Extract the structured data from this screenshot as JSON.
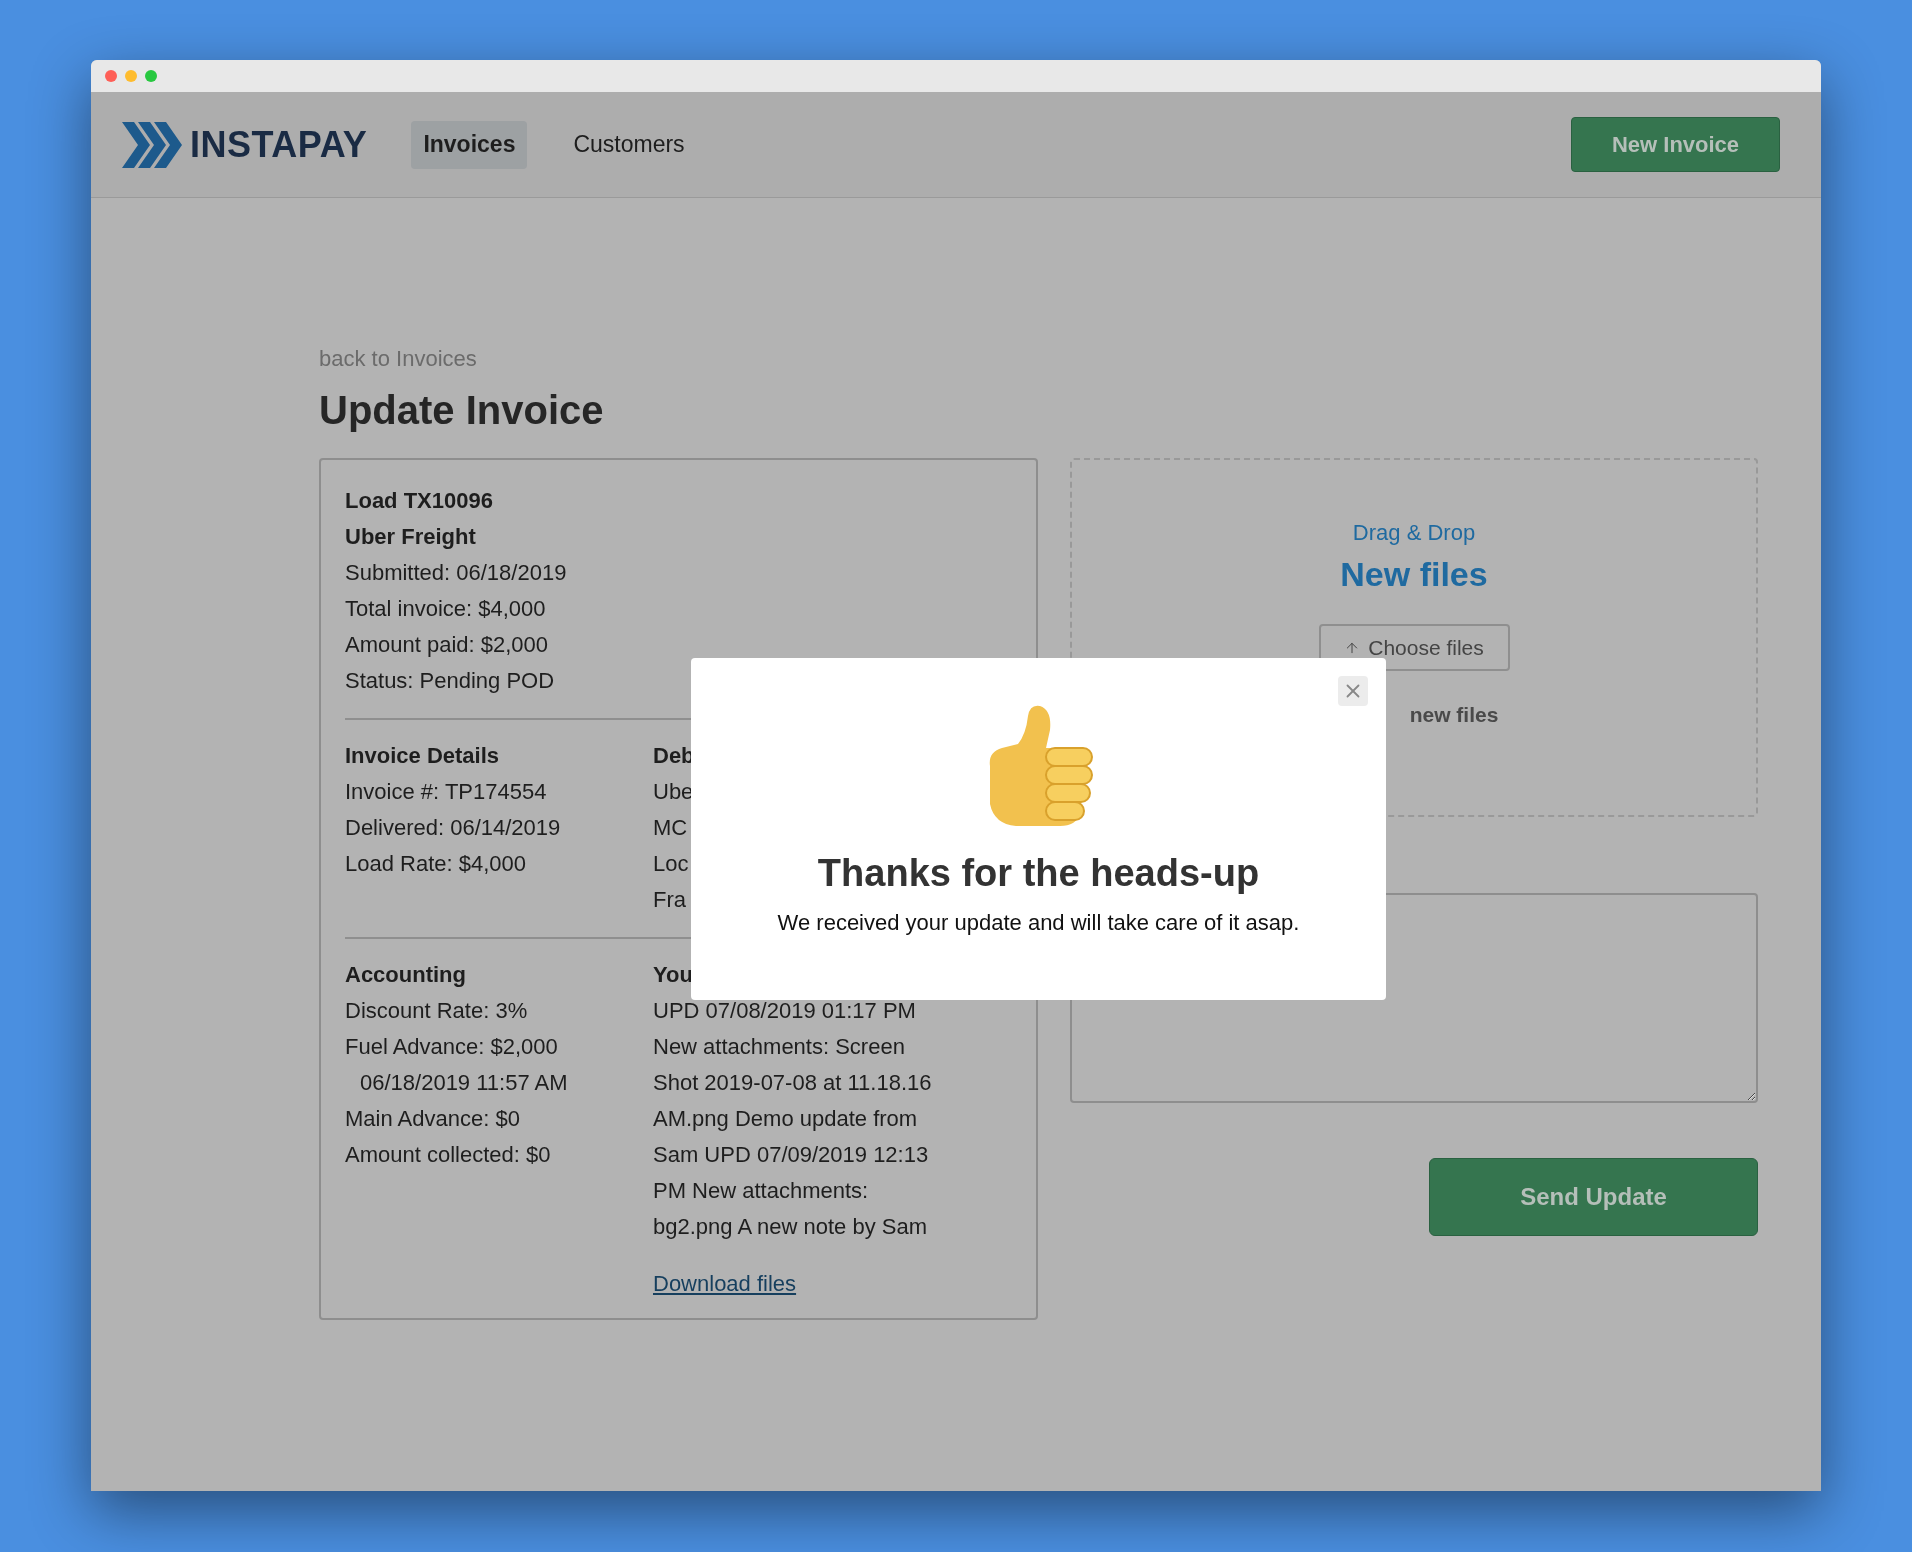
{
  "nav": {
    "brand": "INSTAPAY",
    "tabs": [
      {
        "label": "Invoices",
        "selected": true
      },
      {
        "label": "Customers",
        "selected": false
      }
    ],
    "action": "New Invoice"
  },
  "page": {
    "back_link": "back to Invoices",
    "title": "Update Invoice"
  },
  "summary": [
    {
      "text": "Load TX10096",
      "bold": true
    },
    {
      "text": "Uber Freight",
      "bold": true
    },
    {
      "text": "Submitted: 06/18/2019",
      "bold": false
    },
    {
      "text": "Total invoice: $4,000",
      "bold": false
    },
    {
      "text": "Amount paid: $2,000",
      "bold": false
    },
    {
      "text": "Status: Pending POD",
      "bold": false
    }
  ],
  "sections": [
    {
      "columns": [
        {
          "heading": "Invoice Details",
          "lines": [
            {
              "text": "Invoice #: TP174554",
              "indented": false
            },
            {
              "text": "Delivered: 06/14/2019",
              "indented": false
            },
            {
              "text": "Load Rate: $4,000",
              "indented": false
            }
          ]
        },
        {
          "heading": "Deb",
          "lines": [
            {
              "text": "Ube",
              "indented": false
            },
            {
              "text": "MC",
              "indented": false
            },
            {
              "text": "Loc",
              "indented": false
            },
            {
              "text": "Fra",
              "indented": false
            }
          ]
        }
      ]
    },
    {
      "columns": [
        {
          "heading": "Accounting",
          "lines": [
            {
              "text": "Discount Rate: 3%",
              "indented": false
            },
            {
              "text": "Fuel Advance: $2,000",
              "indented": false
            },
            {
              "text": "06/18/2019 11:57 AM",
              "indented": true
            },
            {
              "text": "Main Advance: $0",
              "indented": false
            },
            {
              "text": "Amount collected: $0",
              "indented": false
            }
          ]
        },
        {
          "heading": "You",
          "lines": [
            {
              "text": "UPD 07/08/2019 01:17 PM",
              "indented": false
            },
            {
              "text": "New attachments: Screen",
              "indented": false
            },
            {
              "text": "Shot 2019-07-08 at 11.18.16",
              "indented": false
            },
            {
              "text": "AM.png Demo update from",
              "indented": false
            },
            {
              "text": "Sam UPD 07/09/2019 12:13",
              "indented": false
            },
            {
              "text": "PM New attachments:",
              "indented": false
            },
            {
              "text": "bg2.png A new note by Sam",
              "indented": false
            }
          ],
          "link": "Download files"
        }
      ]
    }
  ],
  "dropzone": {
    "hint": "Drag & Drop",
    "title": "New files",
    "button": "Choose files",
    "status": "new files"
  },
  "submit": "Send Update",
  "modal": {
    "title": "Thanks for the heads-up",
    "message": "We received your update and will take care of it asap."
  }
}
